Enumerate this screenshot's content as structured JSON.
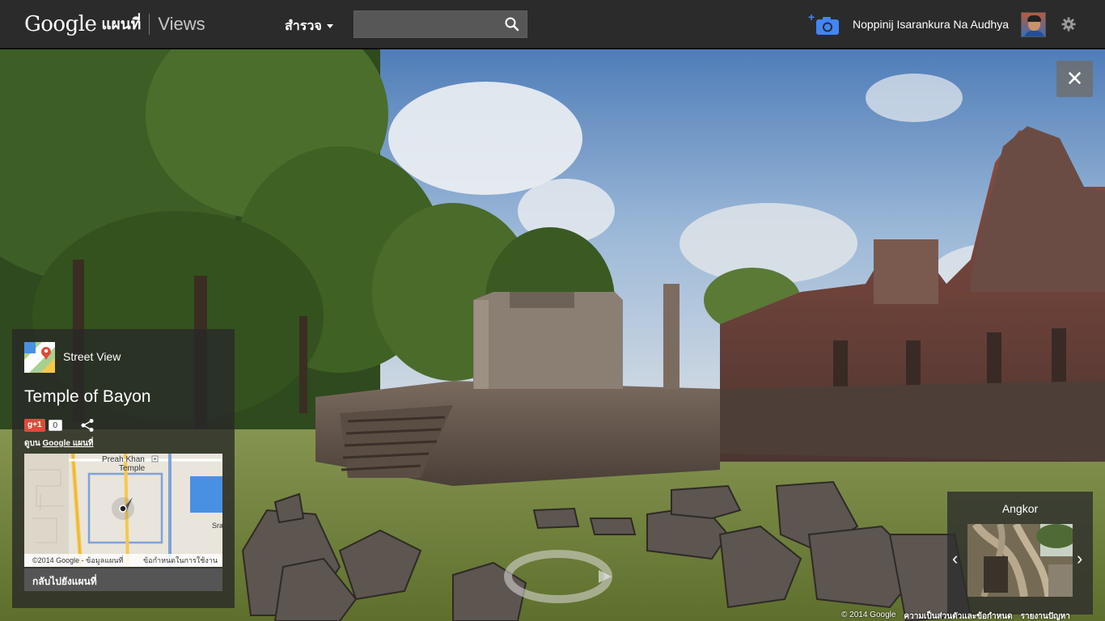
{
  "header": {
    "logo_google": "Google",
    "logo_maps": "แผนที่",
    "logo_views": "Views",
    "explore_label": "สำรวจ",
    "search": {
      "value": "",
      "placeholder": ""
    },
    "username": "Noppinij Isarankura Na Audhya"
  },
  "viewer": {
    "close_label": "✕"
  },
  "info_panel": {
    "street_view_label": "Street View",
    "title": "Temple of Bayon",
    "gplus_label": "g+1",
    "gplus_count": "0",
    "on_maps_prefix": "ดูบน",
    "on_maps_link": "Google แผนที่",
    "map_place_label_line1": "Preah Khan",
    "map_place_label_line2": "Temple",
    "map_edge_label": "Sra",
    "map_copyright": "©2014 Google - ข้อมูลแผนที่",
    "map_terms": "ข้อกำหนดในการใช้งาน",
    "back_to_map": "กลับไปยังแผนที่"
  },
  "album": {
    "title": "Angkor",
    "prev": "‹",
    "next": "›"
  },
  "footer": {
    "copyright": "© 2014 Google",
    "privacy": "ความเป็นส่วนตัวและข้อกำหนด",
    "report": "รายงานปัญหา"
  },
  "icons": {
    "search": "search-icon",
    "add_photo": "camera-plus-icon",
    "settings": "gear-icon",
    "share": "share-icon",
    "street_view": "street-view-icon",
    "close": "close-icon"
  },
  "colors": {
    "topbar": "#2b2b2b",
    "panel": "#282828",
    "gplus": "#dd4b39",
    "camera_blue": "#4285f4",
    "map_road": "#f7c84a",
    "map_water": "#4a90e2"
  }
}
